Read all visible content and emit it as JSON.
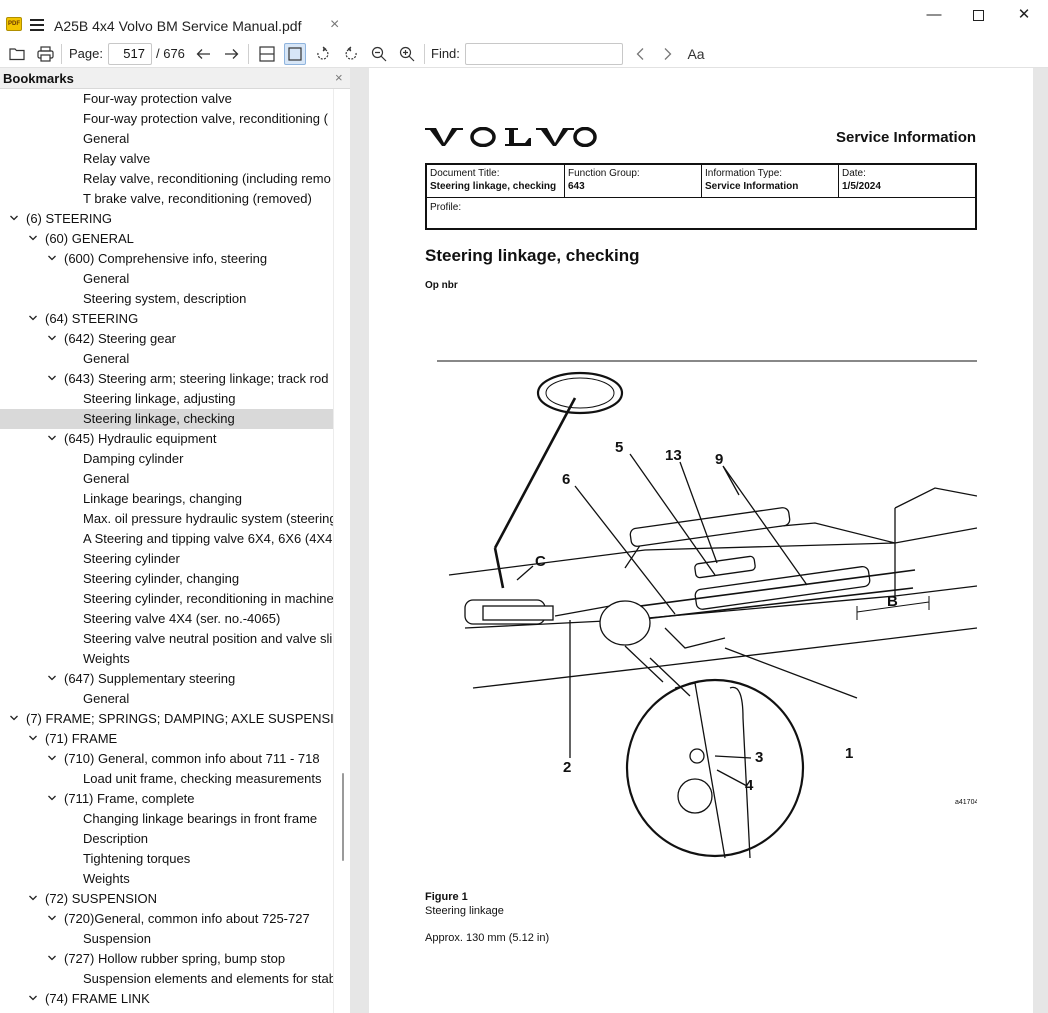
{
  "titlebar": {
    "app_icon": "pdf-app-icon",
    "app_icon_text": "PDF",
    "document_tab": "A25B 4x4 Volvo BM Service Manual.pdf",
    "tab_close": "×",
    "minimize": "—",
    "close": "✕"
  },
  "toolbar": {
    "page_label": "Page:",
    "page_current": "517",
    "page_total": "/ 676",
    "find_label": "Find:",
    "find_value": "",
    "icons": [
      "folder-open-icon",
      "print-icon",
      "arrow-left-icon",
      "arrow-right-icon",
      "fit-width-icon",
      "fit-page-icon",
      "rotate-left-icon",
      "rotate-right-icon",
      "zoom-out-icon",
      "zoom-in-icon",
      "find-prev-icon",
      "find-next-icon",
      "match-case-icon"
    ],
    "match_case_label": "Aa"
  },
  "bookmarks": {
    "title": "Bookmarks",
    "close": "×",
    "items": [
      {
        "label": "Four-way protection valve",
        "level": 3,
        "chevron": ""
      },
      {
        "label": "Four-way protection valve, reconditioning (",
        "level": 3,
        "chevron": ""
      },
      {
        "label": "General",
        "level": 3,
        "chevron": ""
      },
      {
        "label": "Relay valve",
        "level": 3,
        "chevron": ""
      },
      {
        "label": "Relay valve, reconditioning (including remo",
        "level": 3,
        "chevron": ""
      },
      {
        "label": "T brake valve, reconditioning (removed)",
        "level": 3,
        "chevron": ""
      },
      {
        "label": "(6) STEERING",
        "level": 0,
        "chevron": "v"
      },
      {
        "label": "(60) GENERAL",
        "level": 1,
        "chevron": "v"
      },
      {
        "label": "(600) Comprehensive info, steering",
        "level": 2,
        "chevron": "v"
      },
      {
        "label": "General",
        "level": 3,
        "chevron": ""
      },
      {
        "label": "Steering system, description",
        "level": 3,
        "chevron": ""
      },
      {
        "label": "(64) STEERING",
        "level": 1,
        "chevron": "v"
      },
      {
        "label": "(642) Steering gear",
        "level": 2,
        "chevron": "v"
      },
      {
        "label": "General",
        "level": 3,
        "chevron": ""
      },
      {
        "label": "(643) Steering arm; steering linkage; track rod",
        "level": 2,
        "chevron": "v"
      },
      {
        "label": "Steering linkage, adjusting",
        "level": 3,
        "chevron": ""
      },
      {
        "label": "Steering linkage, checking",
        "level": 3,
        "chevron": "",
        "selected": true
      },
      {
        "label": "(645) Hydraulic equipment",
        "level": 2,
        "chevron": "v"
      },
      {
        "label": "Damping cylinder",
        "level": 3,
        "chevron": ""
      },
      {
        "label": "General",
        "level": 3,
        "chevron": ""
      },
      {
        "label": "Linkage bearings, changing",
        "level": 3,
        "chevron": ""
      },
      {
        "label": "Max. oil pressure hydraulic system (steering",
        "level": 3,
        "chevron": ""
      },
      {
        "label": "A Steering and tipping valve 6X4, 6X6 (4X4",
        "level": 3,
        "chevron": ""
      },
      {
        "label": "Steering cylinder",
        "level": 3,
        "chevron": ""
      },
      {
        "label": "Steering cylinder, changing",
        "level": 3,
        "chevron": ""
      },
      {
        "label": "Steering cylinder, reconditioning in machine",
        "level": 3,
        "chevron": ""
      },
      {
        "label": "Steering valve 4X4 (ser. no.-4065)",
        "level": 3,
        "chevron": ""
      },
      {
        "label": "Steering valve neutral position and valve sli",
        "level": 3,
        "chevron": ""
      },
      {
        "label": "Weights",
        "level": 3,
        "chevron": ""
      },
      {
        "label": "(647) Supplementary steering",
        "level": 2,
        "chevron": "v"
      },
      {
        "label": "General",
        "level": 3,
        "chevron": ""
      },
      {
        "label": "(7) FRAME; SPRINGS; DAMPING; AXLE SUSPENSION;",
        "level": 0,
        "chevron": "v"
      },
      {
        "label": "(71) FRAME",
        "level": 1,
        "chevron": "v"
      },
      {
        "label": "(710) General, common info about 711 - 718",
        "level": 2,
        "chevron": "v"
      },
      {
        "label": "Load unit frame, checking measurements",
        "level": 3,
        "chevron": ""
      },
      {
        "label": "(711) Frame, complete",
        "level": 2,
        "chevron": "v"
      },
      {
        "label": "Changing linkage bearings in front frame",
        "level": 3,
        "chevron": ""
      },
      {
        "label": "Description",
        "level": 3,
        "chevron": ""
      },
      {
        "label": "Tightening torques",
        "level": 3,
        "chevron": ""
      },
      {
        "label": "Weights",
        "level": 3,
        "chevron": ""
      },
      {
        "label": "(72) SUSPENSION",
        "level": 1,
        "chevron": "v"
      },
      {
        "label": "(720)General, common info about 725-727",
        "level": 2,
        "chevron": "v"
      },
      {
        "label": "Suspension",
        "level": 3,
        "chevron": ""
      },
      {
        "label": "(727) Hollow rubber spring, bump stop",
        "level": 2,
        "chevron": "v"
      },
      {
        "label": "Suspension elements and elements for stab",
        "level": 3,
        "chevron": ""
      },
      {
        "label": "(74) FRAME LINK",
        "level": 1,
        "chevron": "v"
      }
    ]
  },
  "document": {
    "logo_text": "VOLVO",
    "service_information": "Service Information",
    "info_table": {
      "doc_title_label": "Document Title:",
      "doc_title_value": "Steering linkage, checking",
      "function_group_label": "Function Group:",
      "function_group_value": "643",
      "info_type_label": "Information Type:",
      "info_type_value": "Service Information",
      "date_label": "Date:",
      "date_value": "1/5/2024",
      "profile_label": "Profile:"
    },
    "heading": "Steering linkage, checking",
    "op_nbr": "Op nbr",
    "illustration_labels": [
      "5",
      "13",
      "9",
      "6",
      "C",
      "B",
      "2",
      "3",
      "4",
      "1"
    ],
    "illustration_code": "a41704",
    "figure_title": "Figure 1",
    "figure_caption": "Steering linkage",
    "approx": "Approx. 130 mm (5.12 in)"
  }
}
